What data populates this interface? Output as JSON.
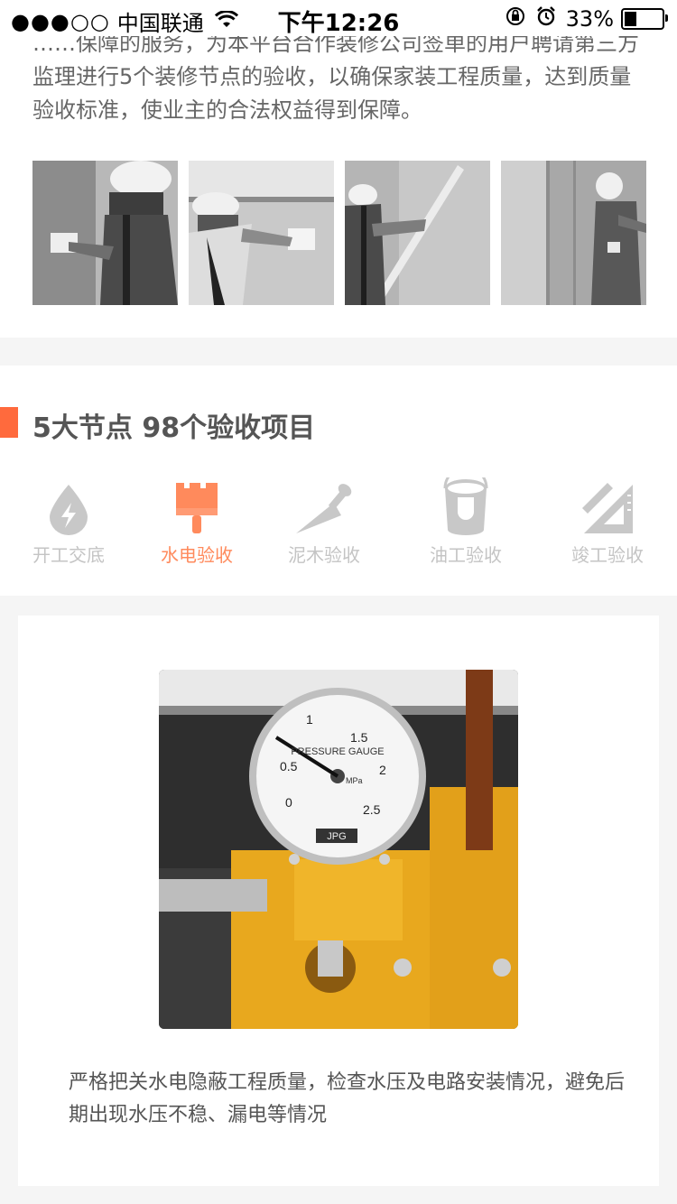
{
  "status_bar": {
    "signal": "●●●○○",
    "carrier": "中国联通",
    "time": "下午12:26",
    "battery": "33%",
    "battery_level": 0.33
  },
  "intro": {
    "text": "……保障的服务，为本平台合作装修公司签单的用户聘请第三方监理进行5个装修节点的验收，以确保家装工程质量，达到质量验收标准，使业主的合法权益得到保障。",
    "photos": [
      "worker-outlet-photo",
      "worker-kitchen-photo",
      "worker-wall-level-photo",
      "worker-bathroom-photo"
    ]
  },
  "nodes": {
    "title": "5大节点 98个验收项目",
    "accent": "#ff6a3d",
    "tabs": [
      {
        "label": "开工交底",
        "icon": "power-drop-icon",
        "active": false
      },
      {
        "label": "水电验收",
        "icon": "brush-icon",
        "active": true
      },
      {
        "label": "泥木验收",
        "icon": "trowel-icon",
        "active": false
      },
      {
        "label": "油工验收",
        "icon": "paint-bucket-icon",
        "active": false
      },
      {
        "label": "竣工验收",
        "icon": "ruler-square-icon",
        "active": false
      }
    ]
  },
  "detail": {
    "image": "pressure-gauge-photo",
    "gauge_text": "PRESSURE GAUGE",
    "gauge_unit": "MPa",
    "gauge_brand": "JPG",
    "gauge_ticks": [
      "0",
      "0.5",
      "1",
      "1.5",
      "2",
      "2.5"
    ],
    "description": "严格把关水电隐蔽工程质量，检查水压及电路安装情况，避免后期出现水压不稳、漏电等情况"
  }
}
